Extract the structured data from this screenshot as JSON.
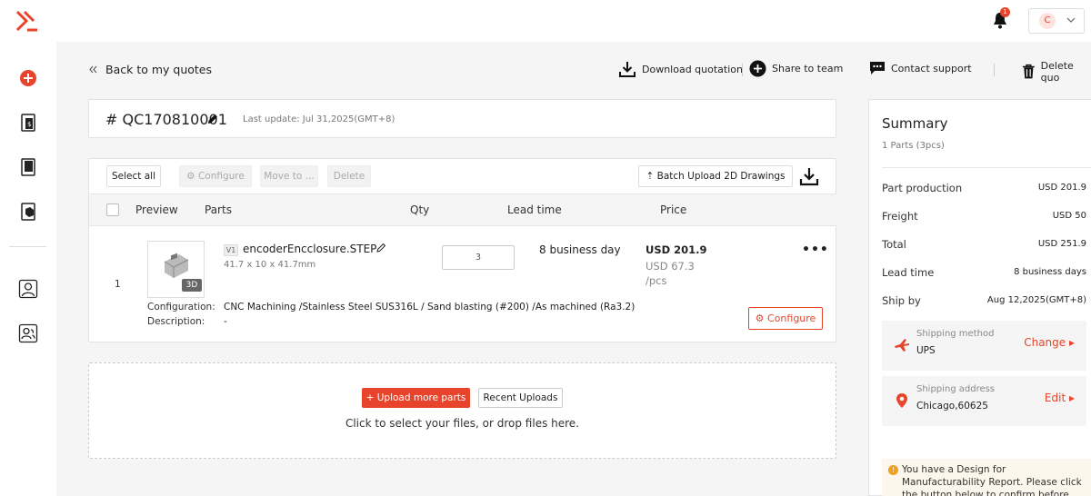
{
  "topbar": {
    "badge_count": "1",
    "avatar_initial": "C"
  },
  "nav": {
    "back_label": "Back to my quotes"
  },
  "actions": {
    "download": "Download quotation",
    "share": "Share to team",
    "contact": "Contact support",
    "delete": "Delete quo"
  },
  "quote": {
    "id": "# QC170810001",
    "last_update": "Last update: Jul 31,2025(GMT+8)"
  },
  "toolbar": {
    "select_all": "Select all",
    "configure": "Configure",
    "move_to": "Move to ...",
    "delete": "Delete",
    "batch_upload": "Batch Upload 2D Drawings"
  },
  "table": {
    "headers": {
      "preview": "Preview",
      "parts": "Parts",
      "qty": "Qty",
      "lead_time": "Lead time",
      "price": "Price"
    },
    "rows": [
      {
        "index": "1",
        "badge": "3D",
        "version": "V1",
        "file_name": "encoderEncclosure.STEP",
        "dimensions": "41.7 x 10 x 41.7mm",
        "qty": "3",
        "lead_time": "8 business day",
        "price": "USD 201.9",
        "unit_price": "USD 67.3 /pcs",
        "configuration_label": "Configuration:",
        "configuration": "CNC Machining /Stainless Steel SUS316L / Sand blasting (#200) /As machined (Ra3.2)",
        "description_label": "Description:",
        "description": "-",
        "configure_button": "Configure"
      }
    ]
  },
  "upload": {
    "upload_more": "+ Upload more parts",
    "recent": "Recent Uploads",
    "hint": "Click to select your files, or drop files here."
  },
  "summary": {
    "title": "Summary",
    "subtitle": "1 Parts (3pcs)",
    "rows": [
      {
        "label": "Part production",
        "value": "USD 201.9"
      },
      {
        "label": "Freight",
        "value": "USD 50"
      },
      {
        "label": "Total",
        "value": "USD 251.9"
      },
      {
        "label": "Lead time",
        "value": "8 business days"
      },
      {
        "label": "Ship by",
        "value": "Aug 12,2025(GMT+8)"
      }
    ],
    "shipping_method": {
      "label": "Shipping method",
      "value": "UPS",
      "action": "Change ▸"
    },
    "shipping_address": {
      "label": "Shipping address",
      "value": "Chicago,60625",
      "action": "Edit ▸"
    },
    "dfm_notice": "You have a Design for Manufacturability Report. Please click the button below to confirm before"
  },
  "colors": {
    "accent": "#e8432b",
    "background": "#f5f5f6"
  }
}
